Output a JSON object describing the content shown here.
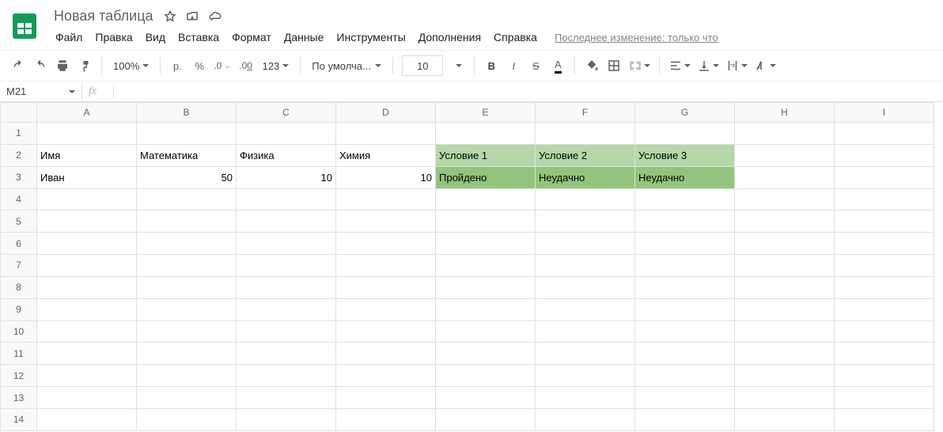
{
  "doc": {
    "title": "Новая таблица",
    "last_edit": "Последнее изменение: только что"
  },
  "menus": [
    "Файл",
    "Правка",
    "Вид",
    "Вставка",
    "Формат",
    "Данные",
    "Инструменты",
    "Дополнения",
    "Справка"
  ],
  "toolbar": {
    "zoom": "100%",
    "currency": "р.",
    "percent": "%",
    "dec_dec": ".0",
    "dec_inc": ".00",
    "more_fmt": "123",
    "font": "По умолча...",
    "fontsize": "10"
  },
  "namebox": "M21",
  "columns": [
    "A",
    "B",
    "C",
    "D",
    "E",
    "F",
    "G",
    "H",
    "I"
  ],
  "row_numbers": [
    1,
    2,
    3,
    4,
    5,
    6,
    7,
    8,
    9,
    10,
    11,
    12,
    13,
    14
  ],
  "cells": {
    "r2": {
      "A": "Имя",
      "B": "Математика",
      "C": "Физика",
      "D": "Химия",
      "E": "Условие 1",
      "F": "Условие 2",
      "G": "Условие 3"
    },
    "r3": {
      "A": "Иван",
      "B": "50",
      "C": "10",
      "D": "10",
      "E": "Пройдено",
      "F": "Неудачно",
      "G": "Неудачно"
    }
  },
  "highlight": {
    "header_bg": "#b6d7a8",
    "row_bg": "#93c47d"
  }
}
